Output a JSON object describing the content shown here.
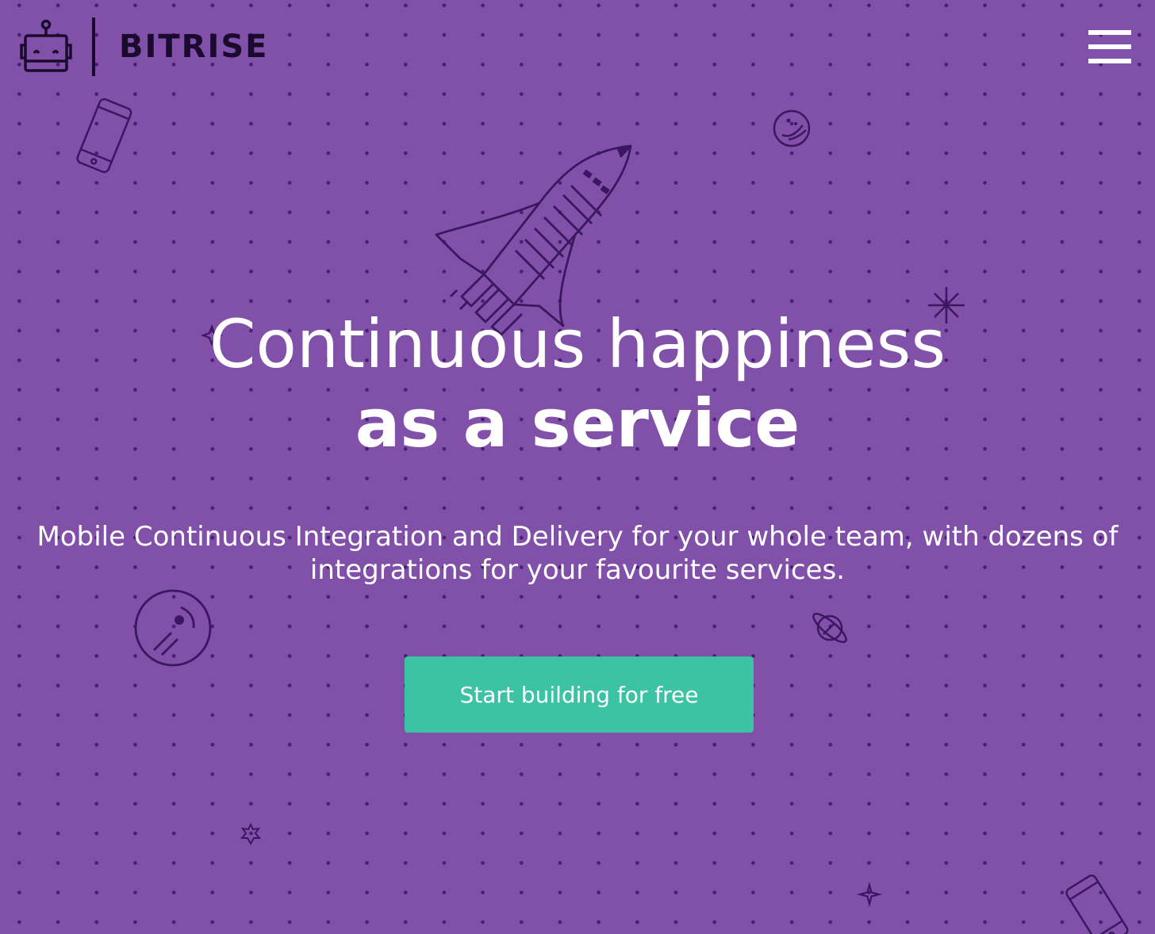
{
  "header": {
    "brand_name": "BITRISE",
    "logo_icon": "robot-logo-icon",
    "menu_icon": "hamburger-menu-icon"
  },
  "hero": {
    "title_line1": "Continuous happiness",
    "title_line2": "as a service",
    "subtitle": "Mobile Continuous Integration and Delivery for your whole team, with dozens of integrations for your favourite services.",
    "cta_label": "Start building for free"
  },
  "decorations": [
    "rocket-icon",
    "phone-icon",
    "moon-icon",
    "planet-icon",
    "sparkle-icon",
    "star-icon"
  ],
  "colors": {
    "background": "#8151a9",
    "dots": "#4a1f73",
    "cta": "#3bc3a3",
    "text": "#ffffff",
    "logo_dark": "#1a0a2e"
  }
}
